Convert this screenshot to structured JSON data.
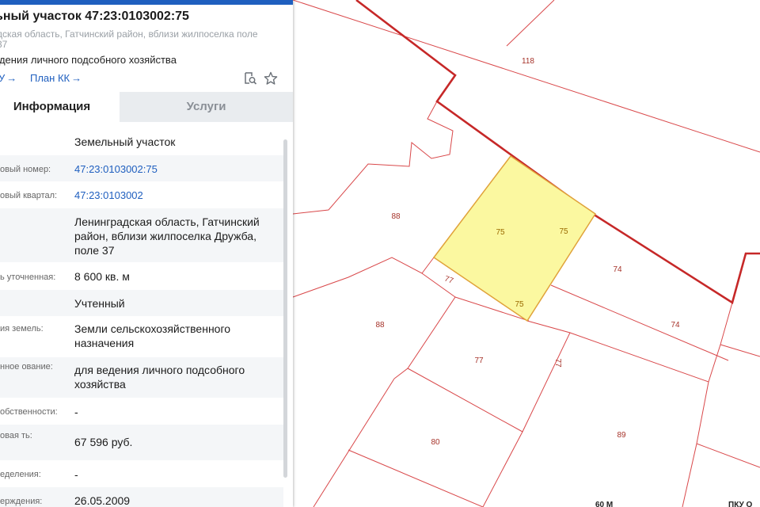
{
  "map": {
    "parcels": [
      {
        "id": "p118",
        "label": "118"
      },
      {
        "id": "p88a",
        "label": "88"
      },
      {
        "id": "p88b",
        "label": "88"
      },
      {
        "id": "p75",
        "label": "75",
        "edge_labels": [
          "75",
          "75"
        ],
        "selected": true
      },
      {
        "id": "p77a",
        "label": "77"
      },
      {
        "id": "p77b",
        "label": "77"
      },
      {
        "id": "p77c",
        "label": "77"
      },
      {
        "id": "p74a",
        "label": "74"
      },
      {
        "id": "p74b",
        "label": "74"
      },
      {
        "id": "p80",
        "label": "80"
      },
      {
        "id": "p89",
        "label": "89"
      }
    ],
    "bottom_labels": [
      "60 М",
      "ПКУ О"
    ],
    "colors": {
      "parcel_outline": "#d9484a",
      "boundary": "#c62828",
      "selected_fill": "#fbf8a0",
      "selected_outline": "#e0a23a"
    }
  },
  "panel": {
    "title": "ьный участок 47:23:0103002:75",
    "address": "дская область, Гатчинский район, вблизи жилпоселка поле 37",
    "purpose": "едения личного подсобного хозяйства",
    "links": {
      "egrn": "У",
      "plan": "План КК"
    },
    "icons": [
      "search-document-icon",
      "star-icon"
    ],
    "tabs": [
      {
        "label": "Информация",
        "active": true
      },
      {
        "label": "Услуги",
        "active": false
      }
    ],
    "rows": [
      {
        "key": "",
        "value": "Земельный участок"
      },
      {
        "key": "овый номер:",
        "value": "47:23:0103002:75",
        "link": true
      },
      {
        "key": "овый квартал:",
        "value": "47:23:0103002",
        "link": true
      },
      {
        "key": "",
        "value": "Ленинградская область, Гатчинский район, вблизи жилпоселка Дружба, поле 37"
      },
      {
        "key": "ь уточненная:",
        "value": "8 600 кв. м"
      },
      {
        "key": "",
        "value": "Учтенный"
      },
      {
        "key": "ия земель:",
        "value": "Земли сельскохозяйственного назначения"
      },
      {
        "key": "нное ование:",
        "value": "для ведения личного подсобного хозяйства"
      },
      {
        "key": "обственности:",
        "value": "-"
      },
      {
        "key": "овая ть:",
        "value": "67 596 руб."
      },
      {
        "key": "еделения:",
        "value": "-"
      },
      {
        "key": "ерждения:",
        "value": "26.05.2009"
      }
    ]
  }
}
